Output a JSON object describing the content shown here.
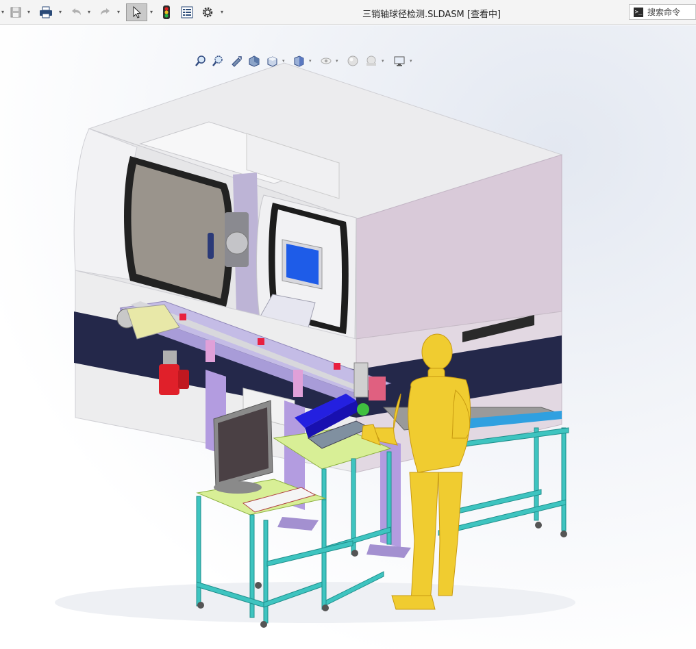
{
  "toolbar": {
    "title": "三销轴球径检测.SLDASM [查看中]",
    "search_placeholder": "搜索命令",
    "search_prompt_glyph": ">_",
    "icons": [
      "save-icon",
      "print-icon",
      "undo-icon",
      "redo-icon",
      "select-pointer-icon",
      "traffic-light-icon",
      "feature-manager-icon",
      "options-gear-icon"
    ]
  },
  "heads_up_toolbar": {
    "icons": [
      "zoom-to-fit-icon",
      "zoom-to-area-icon",
      "previous-view-icon",
      "section-view-icon",
      "view-orientation-icon",
      "display-style-icon",
      "hide-show-items-icon",
      "edit-appearance-icon",
      "apply-scene-icon",
      "view-settings-icon"
    ]
  },
  "colors": {
    "machine_body": "#e4e4e6",
    "machine_side": "#d8ccd8",
    "navy_band": "#24284a",
    "frame_teal": "#3ec4c0",
    "table_top": "#d8ef96",
    "conveyor_purple": "#b39ce0",
    "human_figure": "#f0cc30",
    "monitor": "#8a8a8a",
    "screen_blue": "#1e5ce8",
    "motor_red": "#e0202a",
    "tray_blue": "#2420e0"
  }
}
